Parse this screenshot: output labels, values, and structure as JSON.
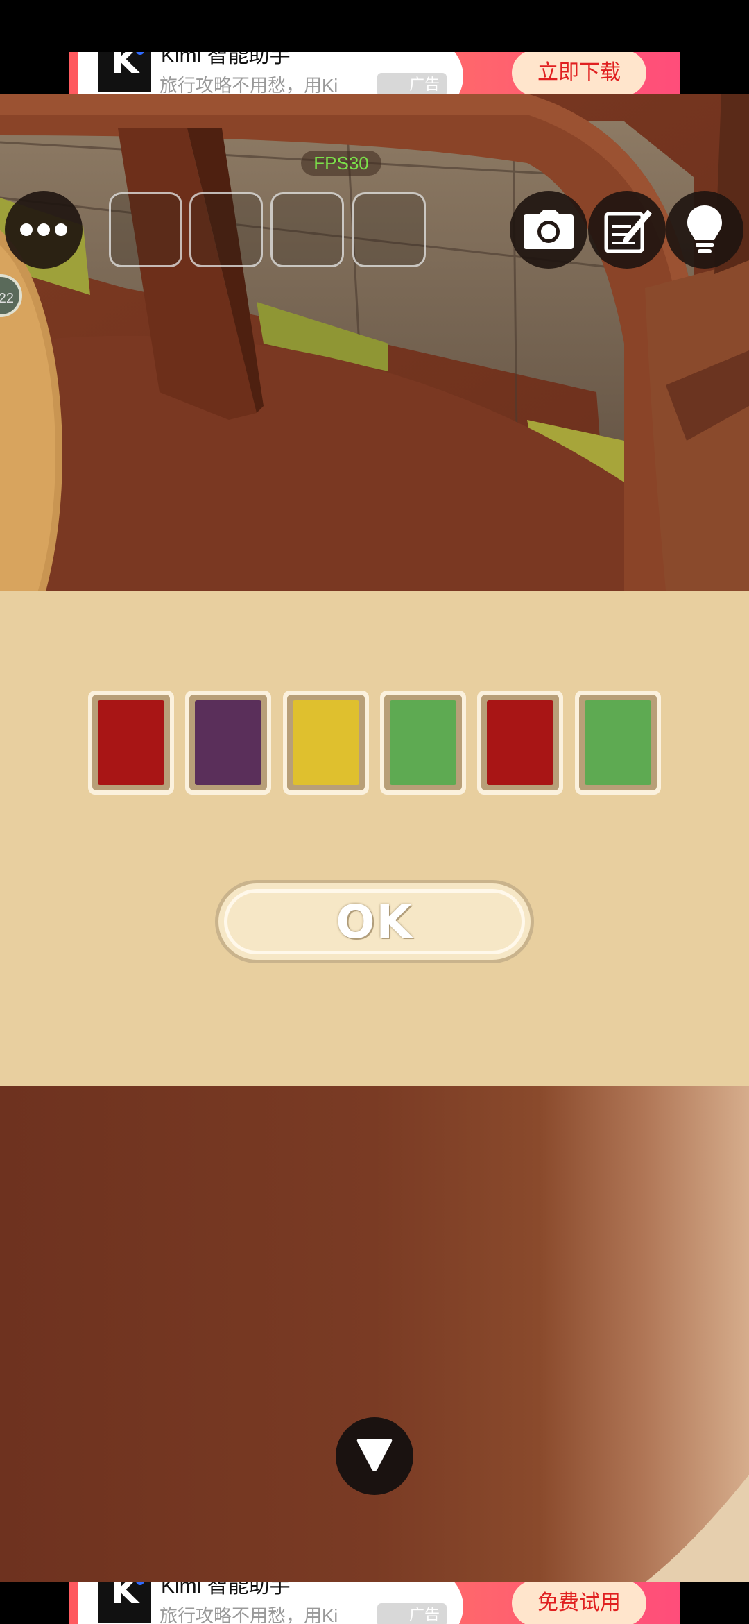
{
  "ad_top": {
    "title": "Kimi 智能助手",
    "subtitle": "旅行攻略不用愁，用Ki",
    "tag": "广告",
    "button": "立即下载",
    "logo_letter": "K"
  },
  "ad_bottom": {
    "title": "Kimi 智能助手",
    "subtitle": "旅行攻略不用愁，用Ki",
    "tag": "广告",
    "button": "免费试用",
    "logo_letter": "K"
  },
  "hud": {
    "fps": "FPS30",
    "side_badge": "22",
    "menu_icon": "more-dots-icon",
    "inventory_slots": 4,
    "tools": [
      "camera-icon",
      "notepad-icon",
      "lightbulb-icon"
    ]
  },
  "puzzle": {
    "tiles": [
      {
        "color": "red",
        "hex": "#a81515"
      },
      {
        "color": "purple",
        "hex": "#5a2f5a"
      },
      {
        "color": "yellow",
        "hex": "#dfc02e"
      },
      {
        "color": "green",
        "hex": "#5eaa52"
      },
      {
        "color": "red",
        "hex": "#a81515"
      },
      {
        "color": "green",
        "hex": "#5eaa52"
      }
    ],
    "ok_label": "OK"
  },
  "nav": {
    "down_icon": "down-arrow-icon"
  }
}
